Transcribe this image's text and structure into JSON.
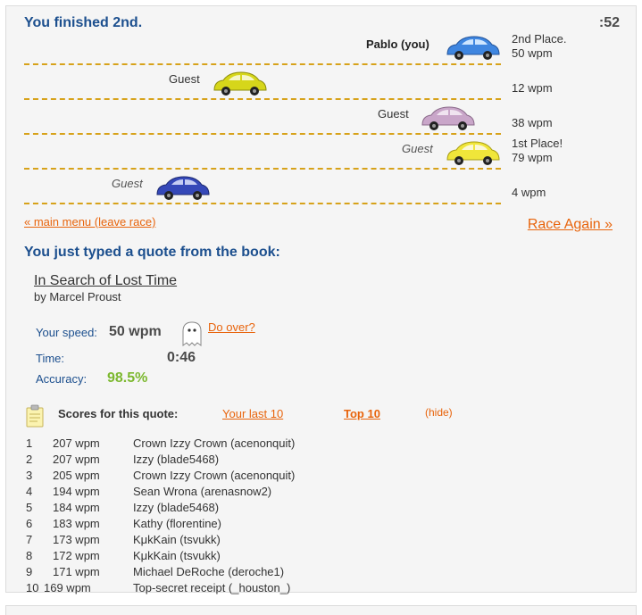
{
  "header": {
    "finished_text": "You finished 2nd.",
    "timer": ":52"
  },
  "racers": [
    {
      "name": "Pablo (you)",
      "place_line1": "2nd Place.",
      "place_line2": "50 wpm",
      "car_color": "#3f86e0"
    },
    {
      "name": "Guest",
      "place_line1": "",
      "place_line2": "12 wpm",
      "car_color": "#d6d61a"
    },
    {
      "name": "Guest",
      "place_line1": "",
      "place_line2": "38 wpm",
      "car_color": "#c9a6c9"
    },
    {
      "name": "Guest",
      "place_line1": "1st Place!",
      "place_line2": "79 wpm",
      "car_color": "#f0e63a"
    },
    {
      "name": "Guest",
      "place_line1": "",
      "place_line2": "4 wpm",
      "car_color": "#3548b8"
    }
  ],
  "links": {
    "main_menu": "« main menu (leave race)",
    "race_again": "Race Again »"
  },
  "quote": {
    "heading": "You just typed a quote from the book:",
    "book_title": "In Search of Lost Time",
    "author": "by Marcel Proust"
  },
  "stats": {
    "speed_label": "Your speed:",
    "speed_value": "50 wpm",
    "do_over": "Do over?",
    "time_label": "Time:",
    "time_value": "0:46",
    "accuracy_label": "Accuracy:",
    "accuracy_value": "98.5%"
  },
  "scores": {
    "title": "Scores for this quote:",
    "your_last_10": "Your last 10",
    "top_10": "Top 10",
    "hide": "(hide)",
    "rows": [
      {
        "rank": "1",
        "wpm": "207 wpm",
        "who": "Crown Izzy Crown (acenonquit)"
      },
      {
        "rank": "2",
        "wpm": "207 wpm",
        "who": "Izzy (blade5468)"
      },
      {
        "rank": "3",
        "wpm": "205 wpm",
        "who": "Crown Izzy Crown (acenonquit)"
      },
      {
        "rank": "4",
        "wpm": "194 wpm",
        "who": "Sean Wrona (arenasnow2)"
      },
      {
        "rank": "5",
        "wpm": "184 wpm",
        "who": "Izzy (blade5468)"
      },
      {
        "rank": "6",
        "wpm": "183 wpm",
        "who": "Kathy (florentine)"
      },
      {
        "rank": "7",
        "wpm": "173 wpm",
        "who": "KμkKain (tsvukk)"
      },
      {
        "rank": "8",
        "wpm": "172 wpm",
        "who": "KμkKain (tsvukk)"
      },
      {
        "rank": "9",
        "wpm": "171 wpm",
        "who": "Michael DeRoche (deroche1)"
      },
      {
        "rank": "10",
        "wpm": "169 wpm",
        "who": "Top-secret receipt (_houston_)"
      }
    ]
  }
}
